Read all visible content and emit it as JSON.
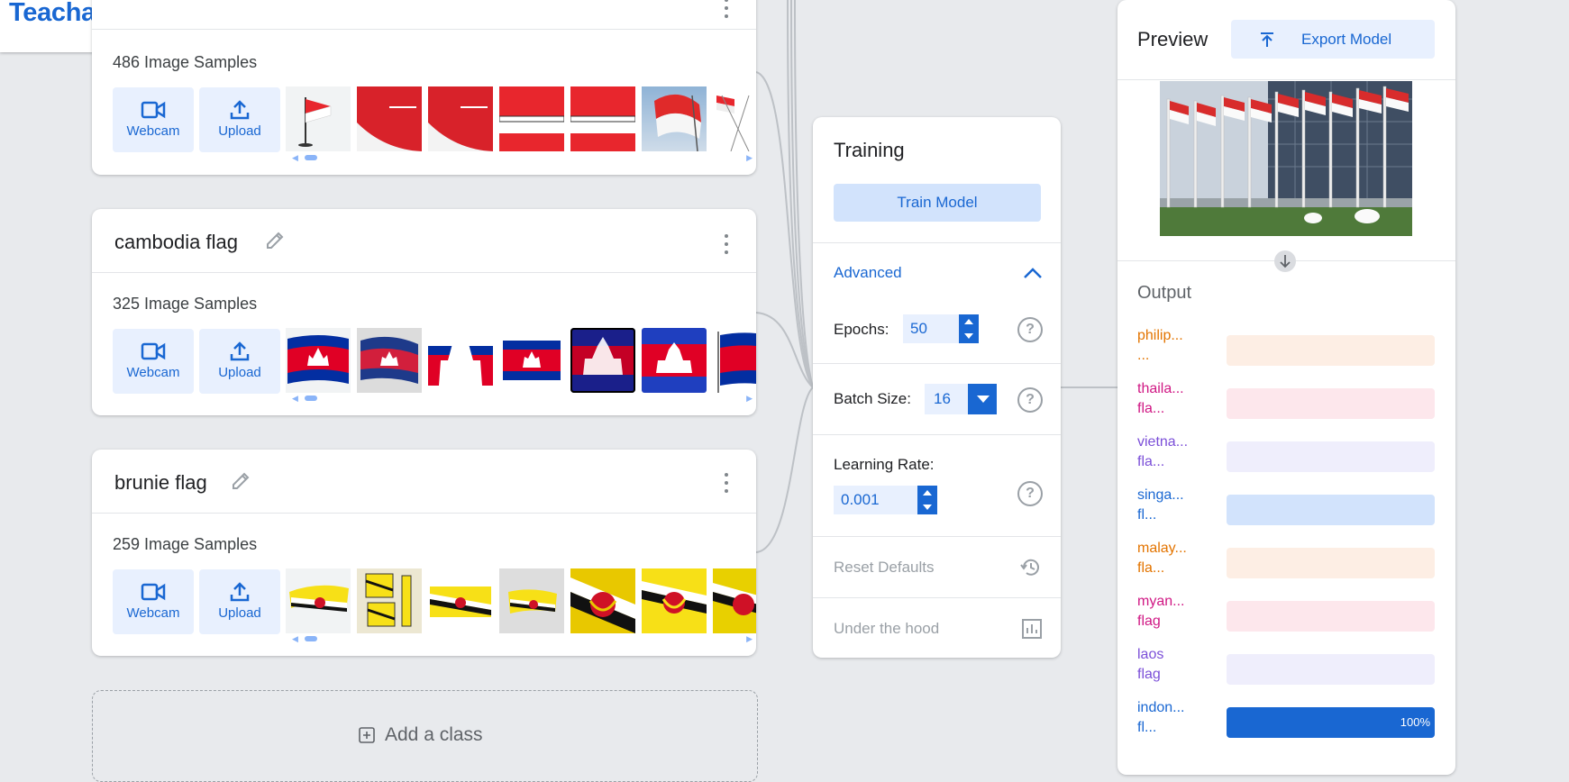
{
  "app": {
    "title": "Teachable Machine"
  },
  "classes": [
    {
      "name": "",
      "samples_label": "486 Image Samples",
      "webcam_label": "Webcam",
      "upload_label": "Upload"
    },
    {
      "name": "cambodia flag",
      "samples_label": "325 Image Samples",
      "webcam_label": "Webcam",
      "upload_label": "Upload"
    },
    {
      "name": "brunie flag",
      "samples_label": "259 Image Samples",
      "webcam_label": "Webcam",
      "upload_label": "Upload"
    }
  ],
  "add_class_label": "Add a class",
  "training": {
    "title": "Training",
    "train_button": "Train Model",
    "advanced_label": "Advanced",
    "epochs_label": "Epochs:",
    "epochs_value": "50",
    "batch_label": "Batch Size:",
    "batch_value": "16",
    "lr_label": "Learning Rate:",
    "lr_value": "0.001",
    "reset_label": "Reset Defaults",
    "hood_label": "Under the hood"
  },
  "preview": {
    "title": "Preview",
    "export_label": "Export Model",
    "output_title": "Output",
    "outputs": [
      {
        "label": "philip...\n...",
        "color": "#e37400",
        "bg": "#fdeee4",
        "value": 0,
        "pct": ""
      },
      {
        "label": "thaila...\nfla...",
        "color": "#d01884",
        "bg": "#fde7ec",
        "value": 0,
        "pct": ""
      },
      {
        "label": "vietna...\nfla...",
        "color": "#7b4fd8",
        "bg": "#efeefc",
        "value": 0,
        "pct": ""
      },
      {
        "label": "singa...\nfl...",
        "color": "#1967d2",
        "bg": "#d2e3fc",
        "value": 0,
        "pct": ""
      },
      {
        "label": "malay...\nfla...",
        "color": "#e37400",
        "bg": "#fdeee4",
        "value": 0,
        "pct": ""
      },
      {
        "label": "myan...\nflag",
        "color": "#d01884",
        "bg": "#fde7ec",
        "value": 0,
        "pct": ""
      },
      {
        "label": "laos\nflag",
        "color": "#7b4fd8",
        "bg": "#efeefc",
        "value": 0,
        "pct": ""
      },
      {
        "label": "indon...\nfl...",
        "color": "#1967d2",
        "bg": "#d2e3fc",
        "value": 1.0,
        "pct": "100%"
      }
    ]
  },
  "colors": {
    "accent": "#1967d2",
    "accent_light": "#e8f0fe",
    "bg": "#e8eaed"
  }
}
